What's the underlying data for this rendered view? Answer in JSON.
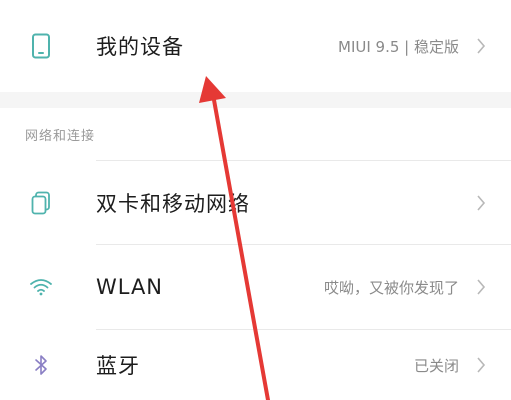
{
  "my_device": {
    "title": "我的设备",
    "value": "MIUI 9.5 | 稳定版",
    "icon": "phone-icon"
  },
  "section": {
    "label": "网络和连接"
  },
  "items": [
    {
      "title": "双卡和移动网络",
      "value": "",
      "icon": "sim-cards-icon"
    },
    {
      "title": "WLAN",
      "value": "哎呦，又被你发现了",
      "icon": "wifi-icon"
    },
    {
      "title": "蓝牙",
      "value": "已关闭",
      "icon": "bluetooth-icon"
    }
  ],
  "colors": {
    "icon_teal": "#4fb3ad",
    "icon_purple": "#8a7fc4",
    "annotation_arrow": "#e53935"
  }
}
